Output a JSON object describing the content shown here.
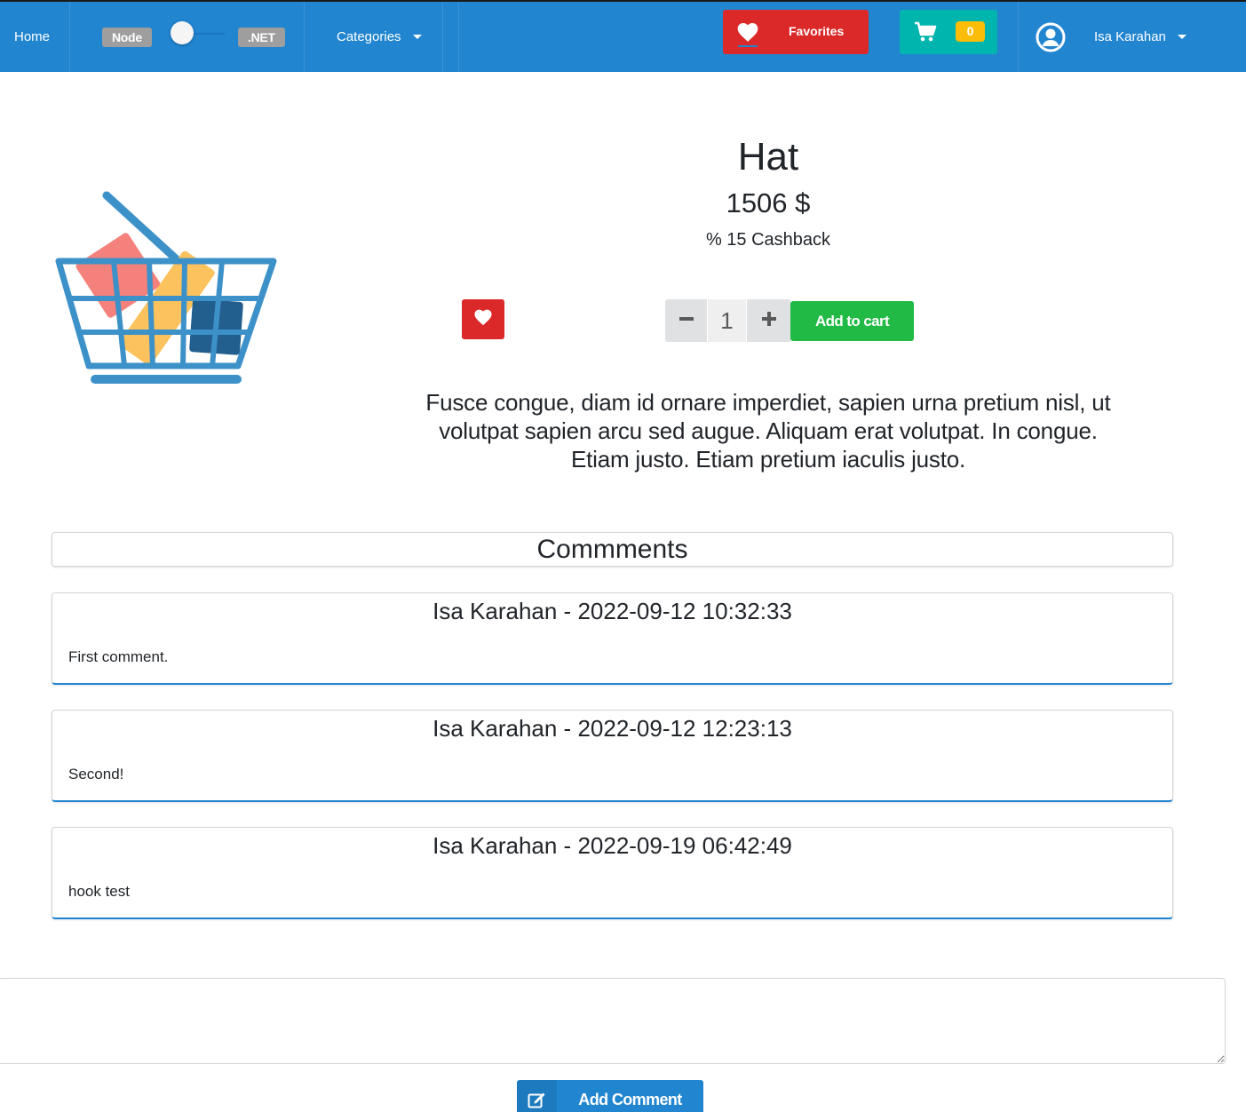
{
  "navbar": {
    "home_label": "Home",
    "backend_left": "Node",
    "backend_right": ".NET",
    "categories_label": "Categories",
    "favorites_label": "Favorites",
    "cart_count": "0",
    "user_name": "Isa Karahan",
    "colors": {
      "bar": "#2185d0",
      "favorites": "#db2828",
      "cart": "#00b5ad",
      "badge": "#fbbd08"
    }
  },
  "product": {
    "title": "Hat",
    "price": "1506 $",
    "cashback": "% 15 Cashback",
    "quantity": "1",
    "add_to_cart_label": "Add to cart",
    "description": "Fusce congue, diam id ornare imperdiet, sapien urna pretium nisl, ut volutpat sapien arcu sed augue. Aliquam erat volutpat. In congue. Etiam justo. Etiam pretium iaculis justo.",
    "image_icon": "shopping-basket-icon"
  },
  "comments": {
    "header": "Commments",
    "items": [
      {
        "heading": "Isa Karahan - 2022-09-12 10:32:33",
        "text": "First comment."
      },
      {
        "heading": "Isa Karahan - 2022-09-12 12:23:13",
        "text": "Second!"
      },
      {
        "heading": "Isa Karahan - 2022-09-19 06:42:49",
        "text": "hook test"
      }
    ],
    "input_value": "",
    "add_comment_label": "Add Comment"
  },
  "colors": {
    "primary": "#2185d0",
    "danger": "#db2828",
    "success": "#21ba45"
  }
}
